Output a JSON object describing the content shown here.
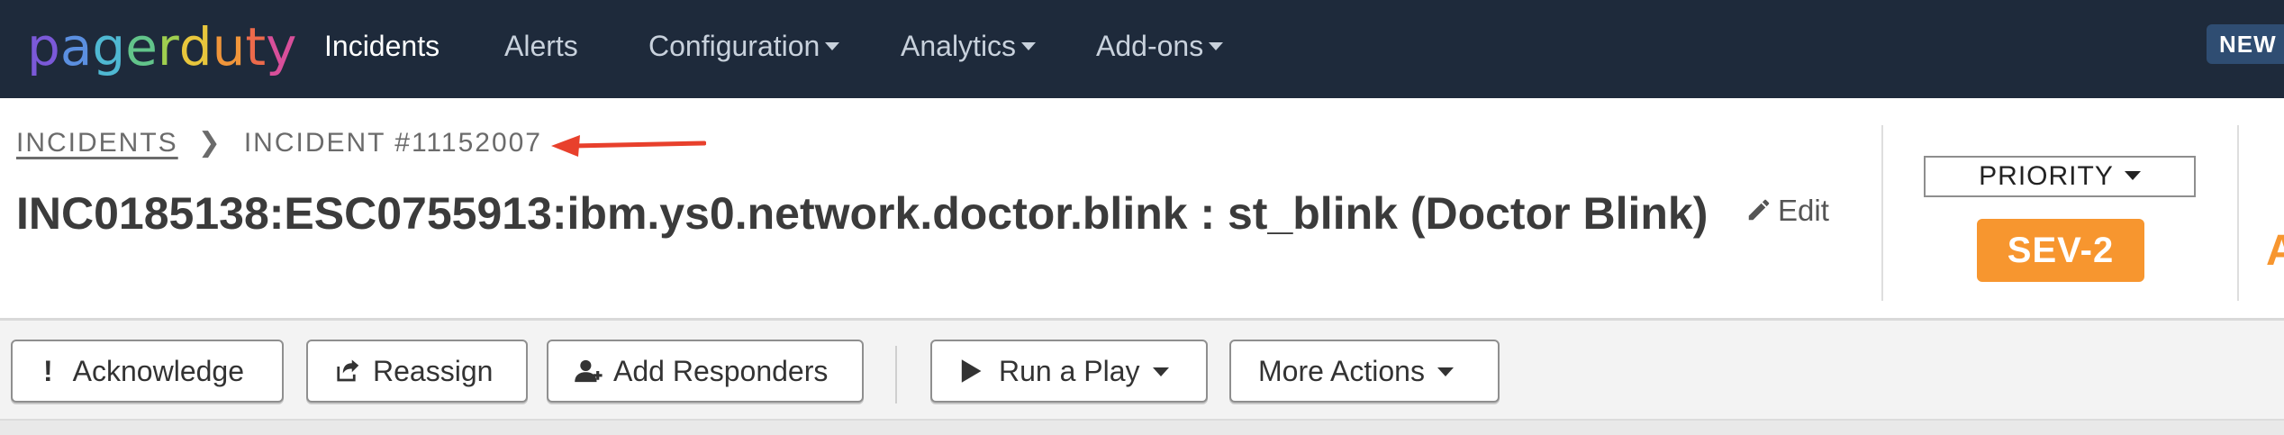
{
  "nav": {
    "logo": "pagerduty",
    "items": [
      {
        "label": "Incidents",
        "active": true,
        "dropdown": false
      },
      {
        "label": "Alerts",
        "active": false,
        "dropdown": false
      },
      {
        "label": "Configuration",
        "active": false,
        "dropdown": true
      },
      {
        "label": "Analytics",
        "active": false,
        "dropdown": true
      },
      {
        "label": "Add-ons",
        "active": false,
        "dropdown": true
      }
    ],
    "new_badge": "NEW"
  },
  "breadcrumb": {
    "root": "INCIDENTS",
    "current": "INCIDENT #11152007"
  },
  "incident": {
    "title": "INC0185138:ESC0755913:ibm.ys0.network.doctor.blink : st_blink (Doctor Blink)",
    "edit_label": "Edit",
    "priority_label": "PRIORITY",
    "severity": "SEV-2",
    "status_peek": "A"
  },
  "actions": {
    "acknowledge": "Acknowledge",
    "reassign": "Reassign",
    "add_responders": "Add Responders",
    "run_play": "Run a Play",
    "more_actions": "More Actions"
  },
  "colors": {
    "nav_bg": "#1e2a3b",
    "severity": "#f7962f",
    "annotation_arrow": "#e8402c"
  }
}
